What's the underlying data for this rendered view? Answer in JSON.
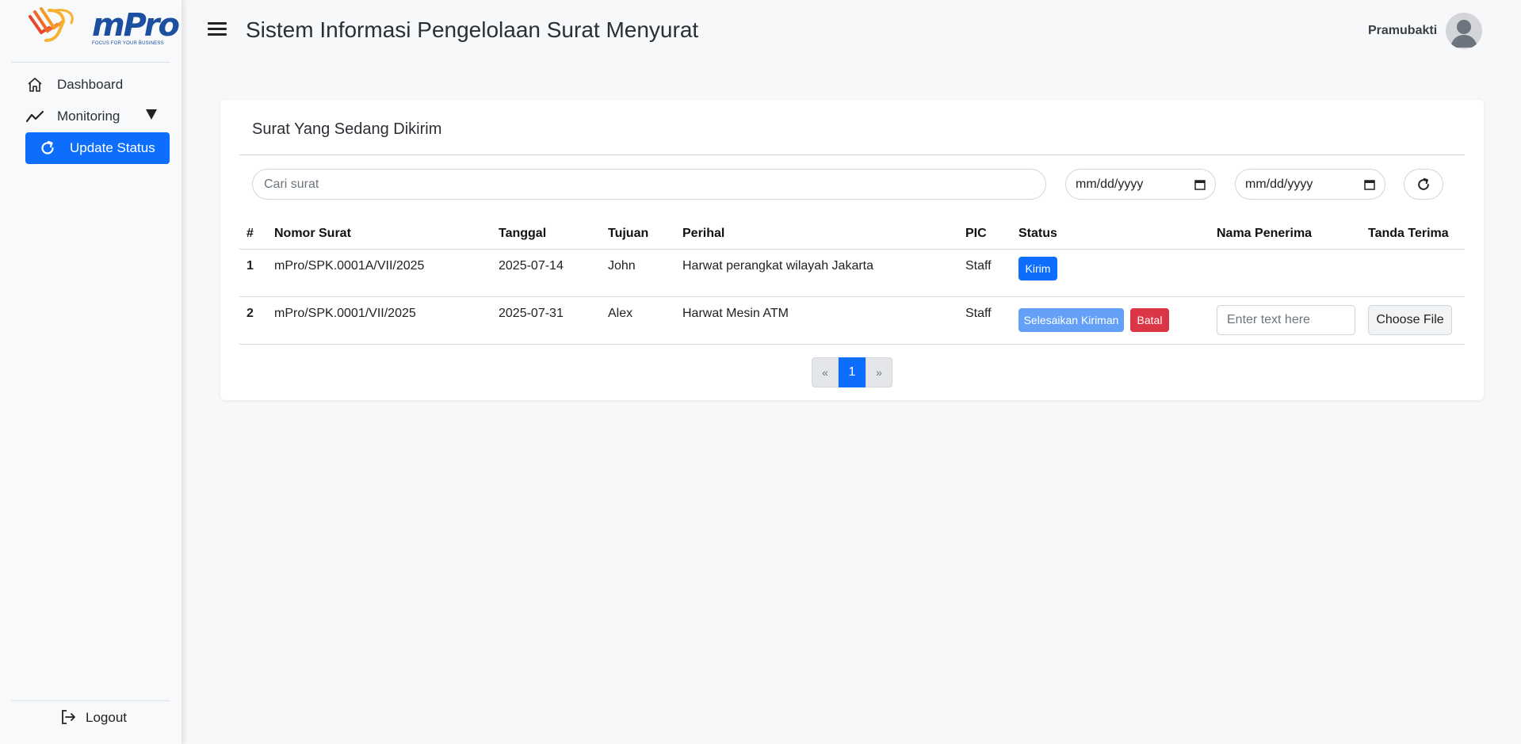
{
  "brand": {
    "name": "mPro",
    "tagline": "FOCUS FOR YOUR BUSINESS",
    "colors": {
      "blue": "#1c4fa0",
      "orange": "#f39a2b",
      "red": "#e5462c"
    }
  },
  "sidebar": {
    "items": [
      {
        "label": "Dashboard",
        "icon": "home-icon"
      },
      {
        "label": "Monitoring",
        "icon": "trend-line-icon"
      },
      {
        "label": "Update Status",
        "icon": "refresh-icon",
        "active": true
      }
    ],
    "logout_label": "Logout"
  },
  "header": {
    "title": "Sistem Informasi Pengelolaan Surat Menyurat",
    "user_name": "Pramubakti"
  },
  "card": {
    "title": "Surat Yang Sedang Dikirim",
    "search_placeholder": "Cari surat",
    "date_from_placeholder": "mm/dd/yyyy",
    "date_to_placeholder": "mm/dd/yyyy"
  },
  "table": {
    "columns": [
      "#",
      "Nomor Surat",
      "Tanggal",
      "Tujuan",
      "Perihal",
      "PIC",
      "Status",
      "Nama Penerima",
      "Tanda Terima"
    ],
    "rows": [
      {
        "no": "1",
        "nomor_surat": "mPro/SPK.0001A/VII/2025",
        "tanggal": "2025-07-14",
        "tujuan": "John",
        "perihal": "Harwat perangkat wilayah Jakarta",
        "pic": "Staff",
        "actions": {
          "kirim": "Kirim"
        }
      },
      {
        "no": "2",
        "nomor_surat": "mPro/SPK.0001/VII/2025",
        "tanggal": "2025-07-31",
        "tujuan": "Alex",
        "perihal": "Harwat Mesin ATM",
        "pic": "Staff",
        "actions": {
          "selesaikan": "Selesaikan Kiriman",
          "batal": "Batal"
        },
        "penerima_placeholder": "Enter text here",
        "file_button": "Choose File"
      }
    ]
  },
  "pagination": {
    "prev": "«",
    "current": "1",
    "next": "»"
  },
  "colors": {
    "primary": "#0d6efd",
    "primary_light": "#64a0f7",
    "danger": "#dc3545"
  }
}
